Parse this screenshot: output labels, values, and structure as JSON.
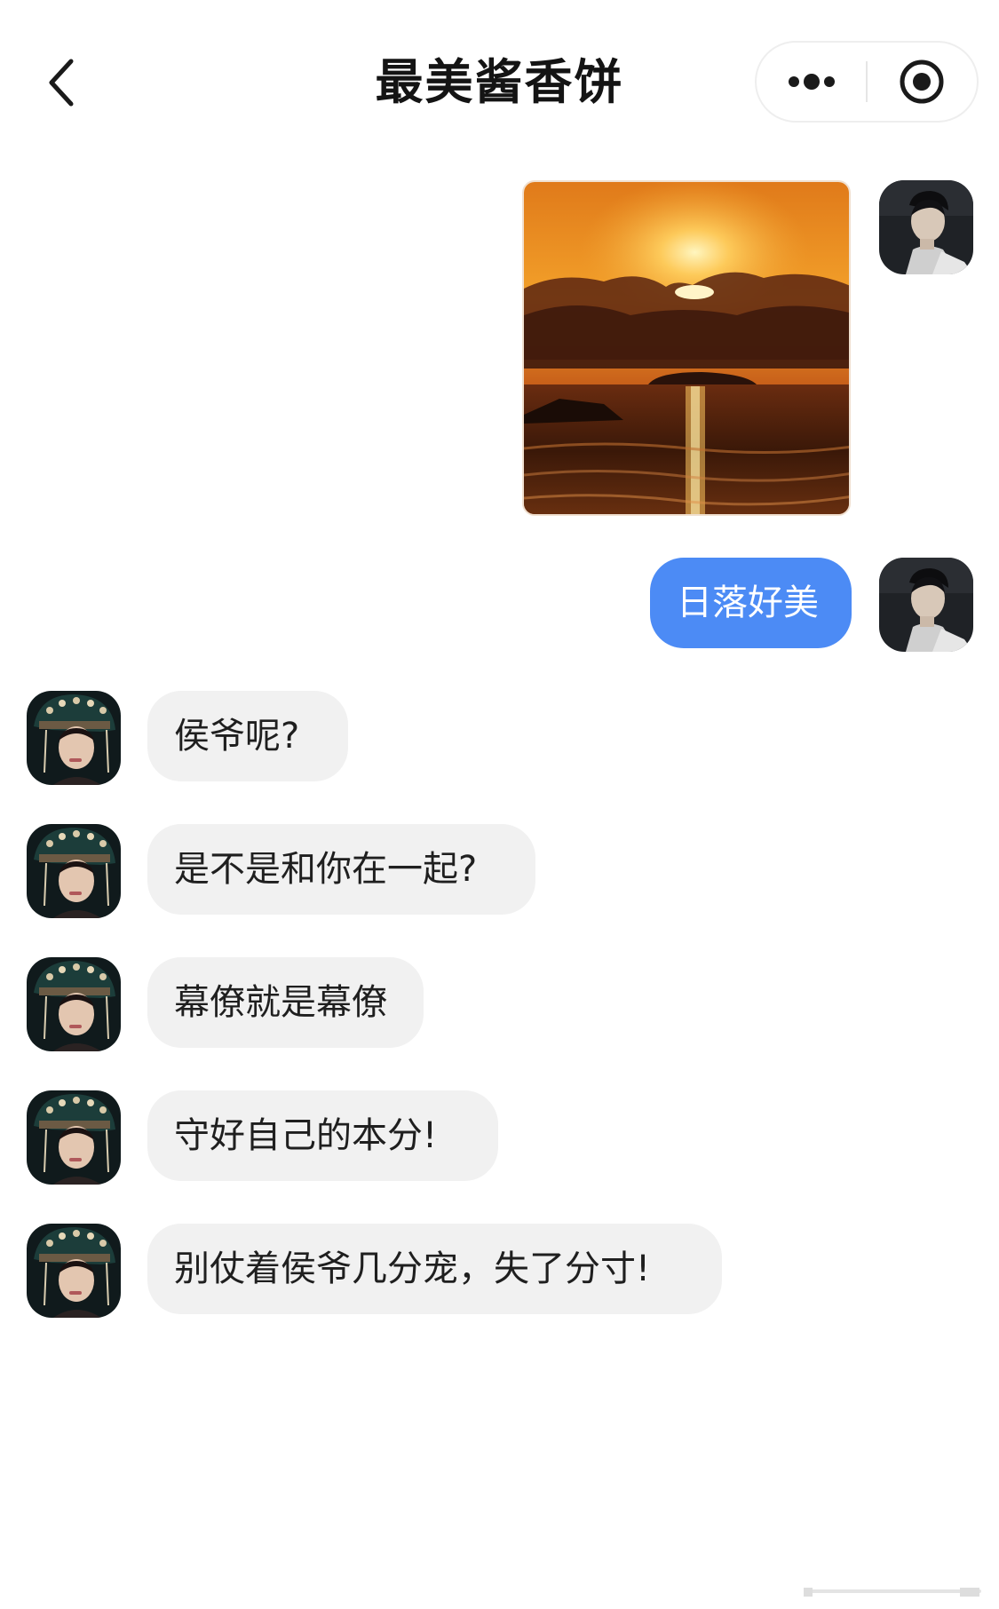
{
  "header": {
    "title": "最美酱香饼",
    "back_icon": "chevron-left-icon",
    "more_icon": "more-dots-icon",
    "close_icon": "target-circle-icon"
  },
  "colors": {
    "outgoing_bubble": "#4c8bf5",
    "incoming_bubble": "#f1f1f1",
    "background": "#ffffff"
  },
  "messages": [
    {
      "from": "me",
      "type": "image",
      "image_name": "sunset-over-sea-photo"
    },
    {
      "from": "me",
      "type": "text",
      "text": "日落好美"
    },
    {
      "from": "other",
      "type": "text",
      "text": "侯爷呢?"
    },
    {
      "from": "other",
      "type": "text",
      "text": "是不是和你在一起?"
    },
    {
      "from": "other",
      "type": "text",
      "text": "幕僚就是幕僚"
    },
    {
      "from": "other",
      "type": "text",
      "text": "守好自己的本分!"
    },
    {
      "from": "other",
      "type": "text",
      "text": "别仗着侯爷几分宠，失了分寸!"
    }
  ]
}
